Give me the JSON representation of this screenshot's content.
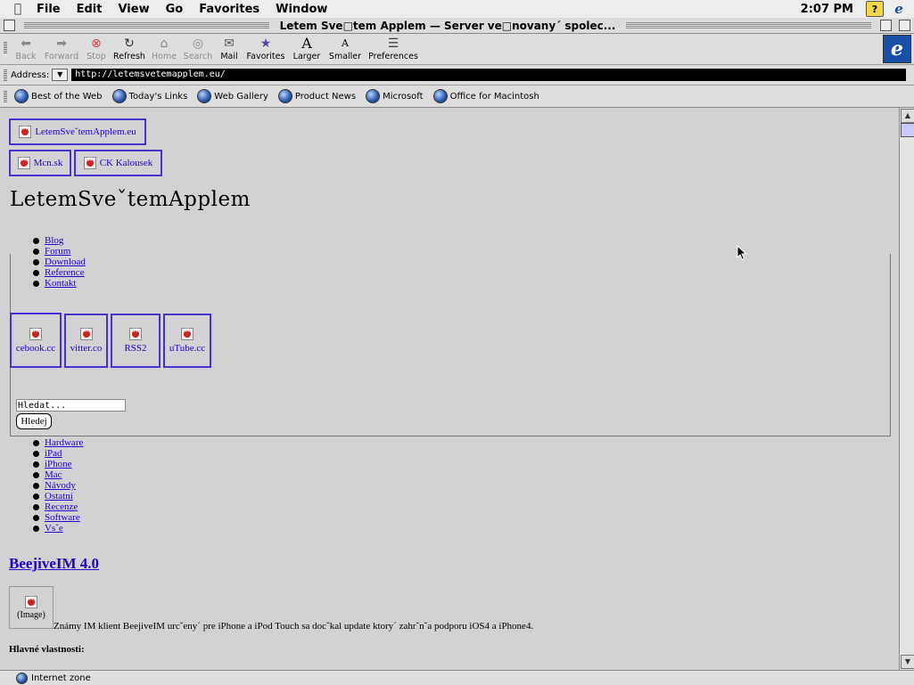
{
  "menubar": {
    "items": [
      "File",
      "Edit",
      "View",
      "Go",
      "Favorites",
      "Window"
    ],
    "clock": "2:07 PM"
  },
  "window": {
    "title": "Letem Sve□tem Applem — Server ve□novany´ spolec..."
  },
  "toolbar": {
    "buttons": [
      {
        "label": "Back",
        "icon": "back-arrow-icon"
      },
      {
        "label": "Forward",
        "icon": "forward-arrow-icon"
      },
      {
        "label": "Stop",
        "icon": "stop-icon"
      },
      {
        "label": "Refresh",
        "icon": "refresh-icon"
      },
      {
        "label": "Home",
        "icon": "home-icon"
      },
      {
        "label": "Search",
        "icon": "search-icon"
      },
      {
        "label": "Mail",
        "icon": "mail-icon"
      },
      {
        "label": "Favorites",
        "icon": "favorites-icon"
      },
      {
        "label": "Larger",
        "icon": "larger-text-icon"
      },
      {
        "label": "Smaller",
        "icon": "smaller-text-icon"
      },
      {
        "label": "Preferences",
        "icon": "preferences-icon"
      }
    ]
  },
  "address": {
    "label": "Address:",
    "url": "http://letemsvetemapplem.eu/"
  },
  "favorites": [
    "Best of the Web",
    "Today's Links",
    "Web Gallery",
    "Product News",
    "Microsoft",
    "Office for Macintosh"
  ],
  "page": {
    "top_images": [
      "LetemSveˇtemApplem.eu",
      "Mcn.sk",
      "CK Kalousek"
    ],
    "site_title": "LetemSveˇtemApplem",
    "nav": [
      "Blog",
      "Forum",
      "Download",
      "Reference",
      "Kontakt"
    ],
    "social": [
      "cebook.cc",
      "vitter.co",
      "RSS2",
      "uTube.cc"
    ],
    "search_value": "Hledat...",
    "search_button": "Hledej",
    "categories": [
      "Hardware",
      "iPad",
      "iPhone",
      "Mac",
      "Návody",
      "Ostatní",
      "Recenze",
      "Software",
      "Vsˇe"
    ],
    "article_title": "BeejiveIM 4.0",
    "article_image_alt": "(Image)",
    "article_text": "Známy IM klient BeejiveIM urcˇeny´ pre iPhone a iPod Touch sa docˇkal update ktory´ zahrˇnˇa podporu iOS4 a iPhone4.",
    "features_heading": "Hlavné vlastnosti:"
  },
  "status": {
    "zone": "Internet zone"
  }
}
